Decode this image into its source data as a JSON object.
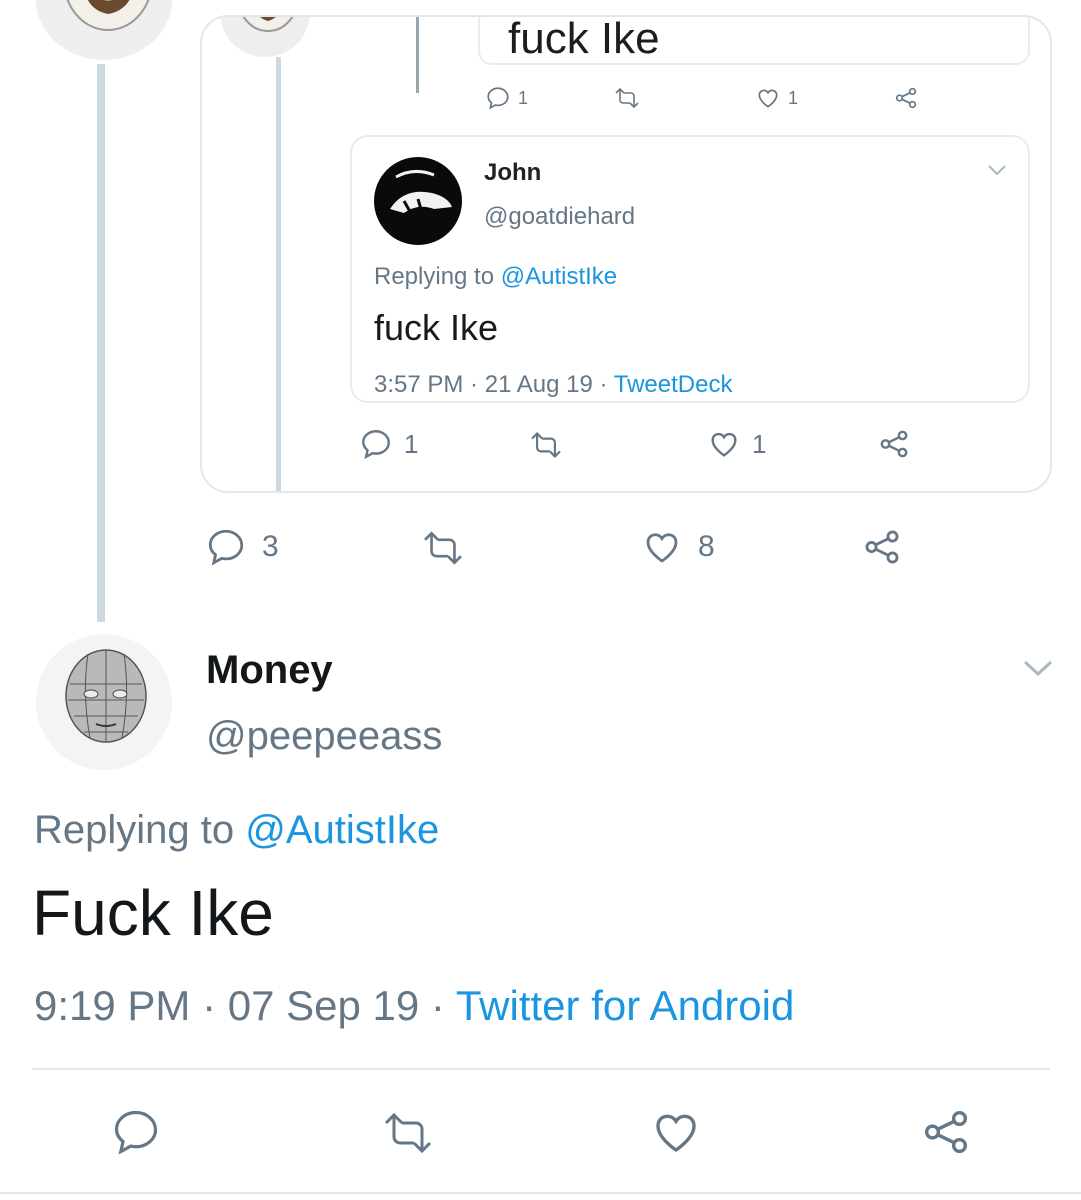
{
  "top_quote": {
    "fragment_text": "fuck Ike",
    "mini_actions": {
      "reply_count": "1",
      "like_count": "1"
    },
    "inner_tweet": {
      "display_name": "John",
      "handle": "@goatdiehard",
      "replying_prefix": "Replying to ",
      "replying_handle": "@AutistIke",
      "text": "fuck Ike",
      "time": "3:57 PM",
      "sep1": " · ",
      "date": "21 Aug 19",
      "sep2": " · ",
      "client": "TweetDeck"
    },
    "actions": {
      "reply_count": "1",
      "like_count": "1"
    }
  },
  "parent_actions": {
    "reply_count": "3",
    "like_count": "8"
  },
  "main_tweet": {
    "display_name": "Money",
    "handle": "@peepeeass",
    "replying_prefix": "Replying to ",
    "replying_handle": "@AutistIke",
    "text": "Fuck Ike",
    "time": "9:19 PM",
    "sep1": " · ",
    "date": "07 Sep 19",
    "sep2": " · ",
    "client": "Twitter for Android"
  },
  "icons": {
    "reply": "reply-icon",
    "retweet": "retweet-icon",
    "like": "heart-icon",
    "share": "share-icon",
    "caret": "chevron-down-icon"
  },
  "colors": {
    "accent": "#1b95e0",
    "secondary": "#657786",
    "text": "#14171a",
    "border": "#e1e8ed"
  }
}
